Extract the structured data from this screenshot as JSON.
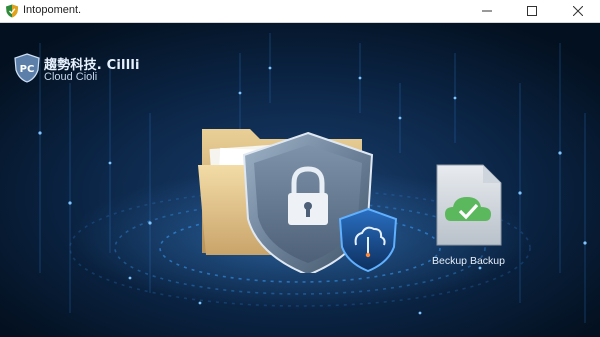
{
  "window": {
    "title": "Intopoment.",
    "controls": {
      "minimize": "minimize-icon",
      "maximize": "maximize-icon",
      "close": "close-icon"
    }
  },
  "brand": {
    "badge_text": "PC",
    "name": "趨勢科技. Cillli",
    "subtitle": "Cloud Cioli"
  },
  "backup": {
    "label": "Beckup Backup",
    "icon": "cloud-check-icon"
  },
  "hero": {
    "folder_icon": "folder-icon",
    "shield_icon": "lock-shield-icon",
    "small_shield_icon": "cloud-sync-shield-icon"
  },
  "colors": {
    "background_center": "#1a3f6e",
    "background_edge": "#03101f",
    "accent_blue": "#3aa0ff",
    "check_green": "#5cb85c"
  }
}
